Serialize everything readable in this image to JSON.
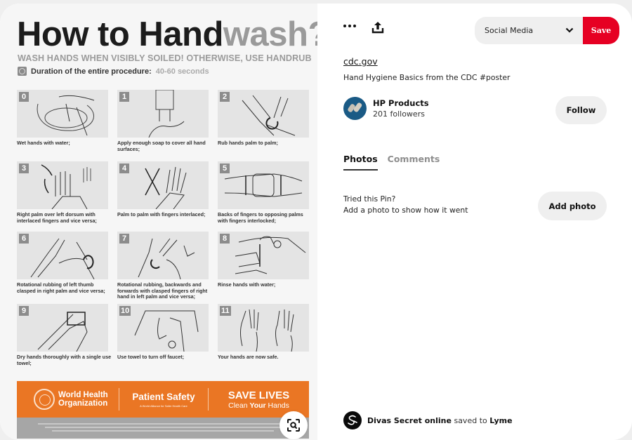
{
  "poster": {
    "title_dark": "How to Hand",
    "title_light": "wash?",
    "subtitle": "WASH HANDS WHEN VISIBLY SOILED! OTHERWISE, USE HANDRUB",
    "duration_label": "Duration of the entire procedure:",
    "duration_value": "40-60 seconds",
    "steps": [
      {
        "num": "0",
        "caption": "Wet hands with water;"
      },
      {
        "num": "1",
        "caption": "Apply enough soap to cover all hand surfaces;"
      },
      {
        "num": "2",
        "caption": "Rub hands palm to palm;"
      },
      {
        "num": "3",
        "caption": "Right palm over left dorsum with interlaced fingers and vice versa;"
      },
      {
        "num": "4",
        "caption": "Palm to palm with fingers interlaced;"
      },
      {
        "num": "5",
        "caption": "Backs of fingers to opposing palms with fingers interlocked;"
      },
      {
        "num": "6",
        "caption": "Rotational rubbing of left thumb clasped in right palm and vice versa;"
      },
      {
        "num": "7",
        "caption": "Rotational rubbing, backwards and forwards with clasped fingers of right hand in left palm and vice versa;"
      },
      {
        "num": "8",
        "caption": "Rinse hands with water;"
      },
      {
        "num": "9",
        "caption": "Dry hands thoroughly with a single use towel;"
      },
      {
        "num": "10",
        "caption": "Use towel to turn off faucet;"
      },
      {
        "num": "11",
        "caption": "Your hands are now safe."
      }
    ],
    "banner": {
      "who_line1": "World Health",
      "who_line2": "Organization",
      "patient_safety": "Patient Safety",
      "patient_safety_sub": "A World Alliance for Safer Health Care",
      "save_lives": "SAVE LIVES",
      "clean_pre": "Clean ",
      "clean_bold": "Your",
      "clean_post": " Hands"
    },
    "colors": {
      "banner": "#ea7624",
      "disclaimer": "#a6a6a6"
    }
  },
  "toolbar": {
    "more_icon": "more-horizontal-icon",
    "share_icon": "share-upload-icon",
    "board_selected": "Social Media",
    "save_label": "Save"
  },
  "pin": {
    "source_link": "cdc.gov",
    "description": "Hand Hygiene Basics from the CDC #poster"
  },
  "creator": {
    "name": "HP Products",
    "followers": "201 followers",
    "follow_label": "Follow"
  },
  "tabs": [
    {
      "label": "Photos",
      "active": true
    },
    {
      "label": "Comments",
      "active": false
    }
  ],
  "tried": {
    "line1": "Tried this Pin?",
    "line2": "Add a photo to show how it went",
    "button": "Add photo"
  },
  "saved_by": {
    "user": "Divas Secret online",
    "verb": " saved to ",
    "board": "Lyme"
  },
  "colors": {
    "save_red": "#e60023",
    "pill_gray": "#efefef"
  }
}
